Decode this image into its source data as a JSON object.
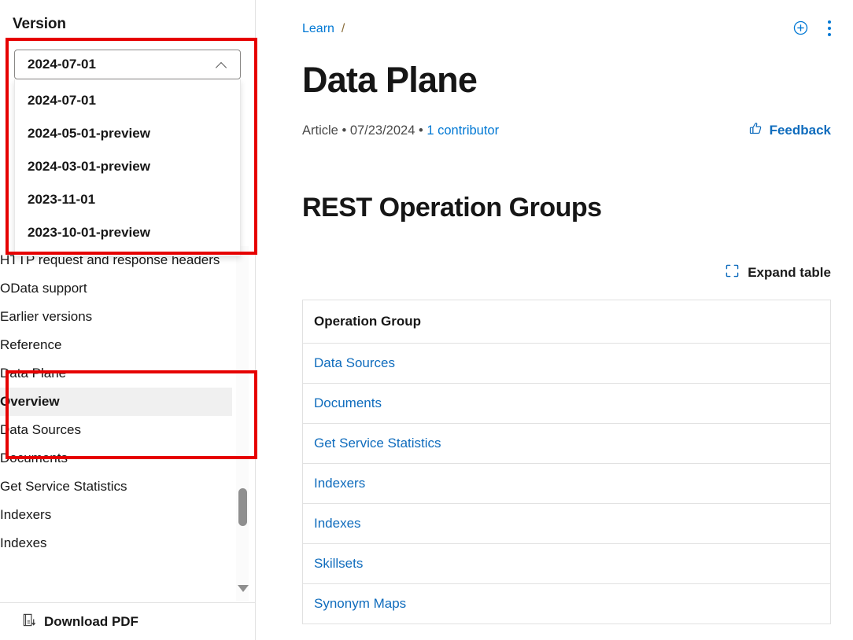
{
  "sidebar": {
    "version_label": "Version",
    "version_selector": {
      "selected": "2024-07-01",
      "expanded": true,
      "chevron_icon": "chevron-up-icon",
      "options": [
        "2024-07-01",
        "2024-05-01-preview",
        "2024-03-01-preview",
        "2023-11-01",
        "2023-10-01-preview"
      ]
    },
    "toc": [
      {
        "label": "HTTP request and response headers",
        "level": 2,
        "caret": "none",
        "selected": false
      },
      {
        "label": "OData support",
        "level": 2,
        "caret": "none",
        "selected": false
      },
      {
        "label": "Earlier versions",
        "level": 1,
        "caret": "right",
        "selected": false
      },
      {
        "label": "Reference",
        "level": 1,
        "caret": "down",
        "selected": false
      },
      {
        "label": "Data Plane",
        "level": 2,
        "caret": "down",
        "selected": false
      },
      {
        "label": "Overview",
        "level": 3,
        "caret": "none",
        "selected": true
      },
      {
        "label": "Data Sources",
        "level": 3,
        "caret": "right",
        "selected": false
      },
      {
        "label": "Documents",
        "level": 3,
        "caret": "right",
        "selected": false
      },
      {
        "label": "Get Service Statistics",
        "level": 3,
        "caret": "right",
        "selected": false
      },
      {
        "label": "Indexers",
        "level": 3,
        "caret": "right",
        "selected": false
      },
      {
        "label": "Indexes",
        "level": 3,
        "caret": "right",
        "selected": false
      }
    ],
    "download_pdf": {
      "label": "Download PDF",
      "icon": "download-pdf-icon"
    },
    "scrollbar": {
      "thumb_icon": "scrollbar-thumb",
      "down_arrow_icon": "scroll-down-arrow-icon"
    }
  },
  "main": {
    "breadcrumb": {
      "root": "Learn",
      "separator": "/"
    },
    "header_actions": {
      "add_icon": "circle-plus-icon",
      "more_icon": "kebab-menu-icon"
    },
    "title": "Data Plane",
    "meta": {
      "type": "Article",
      "bullet1": "•",
      "date": "07/23/2024",
      "bullet2": "•",
      "contributors": "1 contributor"
    },
    "feedback": {
      "label": "Feedback",
      "icon": "thumbs-up-icon"
    },
    "section_title": "REST Operation Groups",
    "expand_table": {
      "label": "Expand table",
      "icon": "expand-icon"
    },
    "table": {
      "columns": [
        "Operation Group"
      ],
      "rows": [
        [
          "Data Sources"
        ],
        [
          "Documents"
        ],
        [
          "Get Service Statistics"
        ],
        [
          "Indexers"
        ],
        [
          "Indexes"
        ],
        [
          "Skillsets"
        ],
        [
          "Synonym Maps"
        ]
      ]
    }
  },
  "annotations": {
    "accent_color": "#e60000",
    "boxes": [
      {
        "name": "version-selector-highlight"
      },
      {
        "name": "reference-tree-highlight"
      }
    ]
  },
  "colors": {
    "link": "#0078d4",
    "link_strong": "#0f6cbd",
    "text": "#171717",
    "annotation_red": "#e60000",
    "selected_row_bg": "#f0f0f0"
  }
}
